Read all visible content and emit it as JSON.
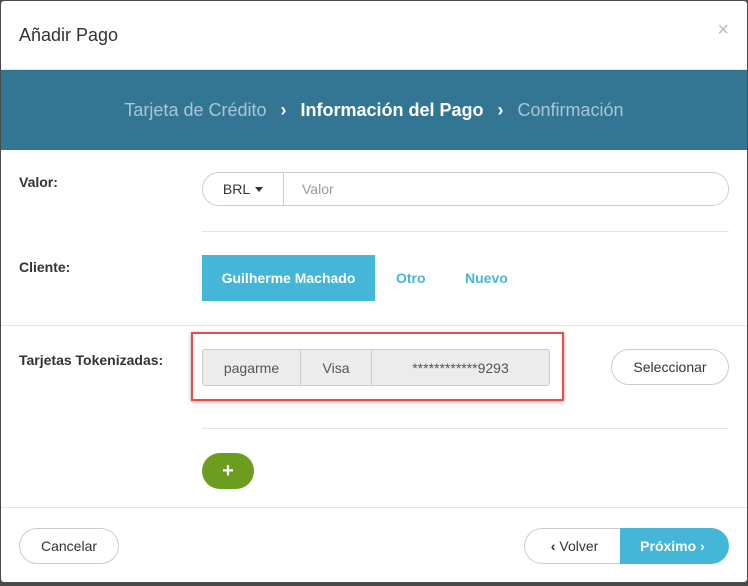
{
  "modal": {
    "title": "Añadir Pago",
    "close_glyph": "×"
  },
  "steps": [
    {
      "label": "Tarjeta de Crédito"
    },
    {
      "label": "Información del Pago"
    },
    {
      "label": "Confirmación"
    }
  ],
  "step_separator": "›",
  "valor": {
    "label": "Valor:",
    "currency": "BRL",
    "placeholder": "Valor",
    "value": ""
  },
  "cliente": {
    "label": "Cliente:",
    "selected": "Guilherme Machado",
    "otro": "Otro",
    "nuevo": "Nuevo"
  },
  "tarjetas": {
    "label": "Tarjetas Tokenizadas:",
    "gateway": "pagarme",
    "brand": "Visa",
    "number": "************9293",
    "select_label": "Seleccionar",
    "add_glyph": "+"
  },
  "footer": {
    "cancel_label": "Cancelar",
    "back_label": "Volver",
    "next_label": "Próximo",
    "back_chevron": "‹",
    "next_chevron": "›"
  },
  "colors": {
    "step_bar": "#337694",
    "accent": "#45b5d8",
    "add_button": "#6b9d1f",
    "highlight": "#e0514e"
  }
}
